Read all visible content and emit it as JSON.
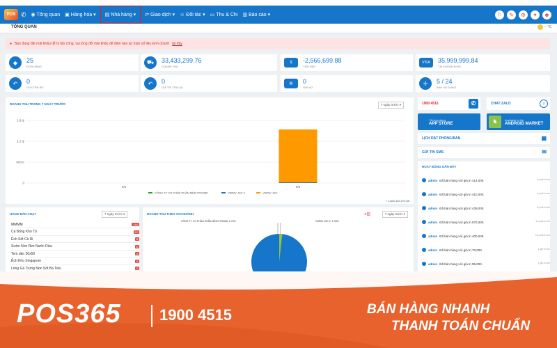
{
  "nav": {
    "logo": "POS",
    "items": [
      {
        "label": "Tổng quan",
        "icon": "dashboard-icon"
      },
      {
        "label": "Hàng hóa",
        "icon": "box-icon"
      },
      {
        "label": "Nhà hàng",
        "icon": "restaurant-icon"
      },
      {
        "label": "Giao dịch",
        "icon": "transaction-icon"
      },
      {
        "label": "Đối tác",
        "icon": "partner-icon"
      },
      {
        "label": "Thu & Chi",
        "icon": "wallet-icon"
      },
      {
        "label": "Báo cáo",
        "icon": "report-icon"
      }
    ]
  },
  "subbar": {
    "title": "TỔNG QUAN",
    "weather": "-- °C"
  },
  "alert": {
    "text": "Bạn đang đặt mật khẩu dễ bị tấn công, vui lòng đổi mật khẩu để đảm bảo an toàn số liệu kinh doanh",
    "link": "tại đây"
  },
  "stats": [
    {
      "value": "25",
      "label": "ĐƠN HÀNG",
      "icon": "tag-icon"
    },
    {
      "value": "33,433,299.76",
      "label": "DOANH THU",
      "icon": "cart-icon"
    },
    {
      "value": "-2,566,699.88",
      "label": "TIỀN MẶT",
      "icon": "cash-icon"
    },
    {
      "value": "35,999,999.84",
      "label": "TÀI KHOẢN KHÁC",
      "icon": "visa-icon"
    },
    {
      "value": "0",
      "label": "HỦY/TRẢ BỎ",
      "icon": "undo-icon"
    },
    {
      "value": "0",
      "label": "GIÁ TRỊ TRẢ LẠI",
      "icon": "return-icon"
    },
    {
      "value": "0",
      "label": "GHI NỢ",
      "icon": "card-icon"
    },
    {
      "value": "5 / 24",
      "label": "BÀN SỬ DỤNG",
      "icon": "target-icon"
    }
  ],
  "revenue_chart": {
    "title": "DOANH THU TRONG 7 NGÀY TRƯỚC",
    "filter": "7 ngày trước",
    "total": "+ 1,826,153,072.85"
  },
  "chart_data": {
    "type": "bar",
    "categories": [
      "5/5",
      "9/5"
    ],
    "series": [
      {
        "name": "CÔNG TY CỔ PHẦN PHẦN MỀM POS365",
        "values": [
          0,
          0
        ],
        "color": "#2ca02c"
      },
      {
        "name": "VNPAY JSC 2",
        "values": [
          0,
          0.02
        ],
        "color": "#1f77b4"
      },
      {
        "name": "VNPAY JSC",
        "values": [
          0,
          1.52
        ],
        "color": "#ff9900"
      }
    ],
    "yticks": [
      "1.8 tỷ",
      "1.2 tỷ",
      "600 tr",
      "0"
    ],
    "ylim": [
      0,
      1.8
    ]
  },
  "best_sellers": {
    "title": "HÀNG BÁN CHẠY",
    "filter": "7 ngày trước",
    "rows": [
      {
        "name": "MMMM",
        "count": "144"
      },
      {
        "name": "Cá Bống Kho Tộ",
        "count": "12"
      },
      {
        "name": "Ếch Sốt Cà Ri",
        "count": "8"
      },
      {
        "name": "Sườn Non Rim Nước Dừa",
        "count": "6"
      },
      {
        "name": "Tem dán 30x50",
        "count": "5"
      },
      {
        "name": "Ếch Kho Singapore",
        "count": "5"
      },
      {
        "name": "Lòng Gà Trứng Non Sốt Ba Tiêu",
        "count": "4"
      }
    ]
  },
  "branch_chart": {
    "title": "DOANH THU THEO CHI NHÁNH",
    "filter": "7 ngày trước",
    "label_a": "CÔNG TY CỔ PHẦN PHẦN MỀM POS365: 1.79%",
    "label_b": "VNPAY JSC 2: 1.93%"
  },
  "side": {
    "hotline": "1900 4515",
    "zalo": "CHAT ZALO",
    "appstore_small": "Tải ứng dụng",
    "appstore_big": "APP STORE",
    "android_small": "Available in the",
    "android_big": "ANDROID MARKET",
    "booking": "LỊCH ĐẶT PHÒNG/BÀN",
    "sms": "GỬI TIN SMS",
    "activity_title": "HOẠT ĐỘNG GẦN ĐÂY",
    "activities": [
      {
        "user": "admin",
        "text": "Đã bán hàng với giá trị 414,000.",
        "time": "2 phút trước"
      },
      {
        "user": "admin",
        "text": "Đã bán hàng với giá trị 410,000.",
        "time": "4 phút trước"
      },
      {
        "user": "admin",
        "text": "Đã bán hàng với giá trị 439,000.",
        "time": "8 phút trước"
      },
      {
        "user": "admin",
        "text": "Đã bán hàng với giá trị 570,000.",
        "time": "11 phút trước"
      },
      {
        "user": "admin",
        "text": "Đã bán hàng với giá trị 400,000.",
        "time": "13 phút trước"
      },
      {
        "user": "admin",
        "text": "Đã bán hàng với giá trị 70,000.",
        "time": "1 giờ trước"
      },
      {
        "user": "admin",
        "text": "Đã bán hàng với giá trị 95,000.",
        "time": "1 giờ trước"
      }
    ]
  },
  "banner": {
    "brand": "POS365",
    "phone": "1900 4515",
    "slogan1": "BÁN HÀNG NHANH",
    "slogan2": "THANH TOÁN CHUẨN"
  }
}
